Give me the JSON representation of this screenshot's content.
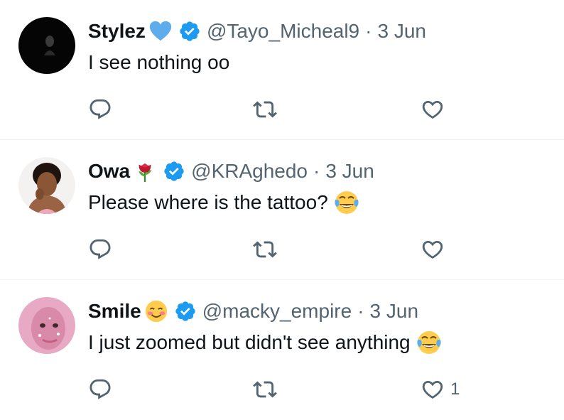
{
  "colors": {
    "text": "#0f1419",
    "secondary": "#536471",
    "verified": "#1d9bf0",
    "divider": "#eff3f4"
  },
  "tweets": [
    {
      "name": "Stylez",
      "name_emoji": "blue-heart-icon",
      "handle": "@Tayo_Micheal9",
      "separator": "·",
      "time": "3 Jun",
      "text": "I see nothing oo",
      "text_emoji": "",
      "like_count": ""
    },
    {
      "name": "Owa",
      "name_emoji": "rose-icon",
      "handle": "@KRAghedo",
      "separator": "·",
      "time": "3 Jun",
      "text": "Please where is the tattoo?",
      "text_emoji": "tears-of-joy-icon",
      "like_count": ""
    },
    {
      "name": "Smile",
      "name_emoji": "smiling-face-icon",
      "handle": "@macky_empire",
      "separator": "·",
      "time": "3 Jun",
      "text": "I just zoomed but didn't see anything",
      "text_emoji": "tears-of-joy-icon",
      "like_count": "1"
    }
  ]
}
